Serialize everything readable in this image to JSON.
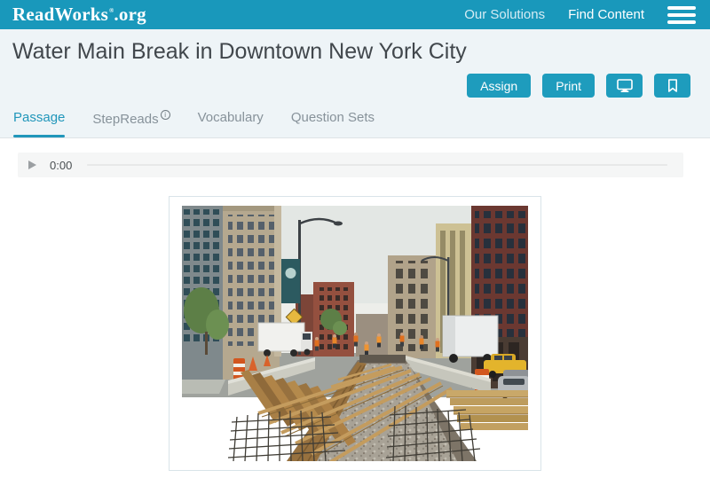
{
  "header": {
    "logo": {
      "name": "ReadWorks",
      "mark": "®",
      "tld": ".org"
    },
    "nav": {
      "our_solutions": "Our Solutions",
      "find_content": "Find Content"
    }
  },
  "page": {
    "title": "Water Main Break in Downtown New York City"
  },
  "actions": {
    "assign": "Assign",
    "print": "Print"
  },
  "tabs": {
    "passage": "Passage",
    "stepreads": "StepReads",
    "stepreads_info": "i",
    "vocabulary": "Vocabulary",
    "question_sets": "Question Sets"
  },
  "audio": {
    "time": "0:00"
  },
  "photo": {
    "alt": "Downtown New York City street with a long excavated water-main trench: wooden cross-beams and formwork, rebar grids, gravel, concrete barriers, orange cones and barrels, white box trucks, a yellow taxi, workers in orange safety vests, and tall brick buildings on both sides."
  },
  "colors": {
    "brand_teal": "#1998bb",
    "active_tab": "#2096ba",
    "hero_bg": "#eef4f7"
  }
}
